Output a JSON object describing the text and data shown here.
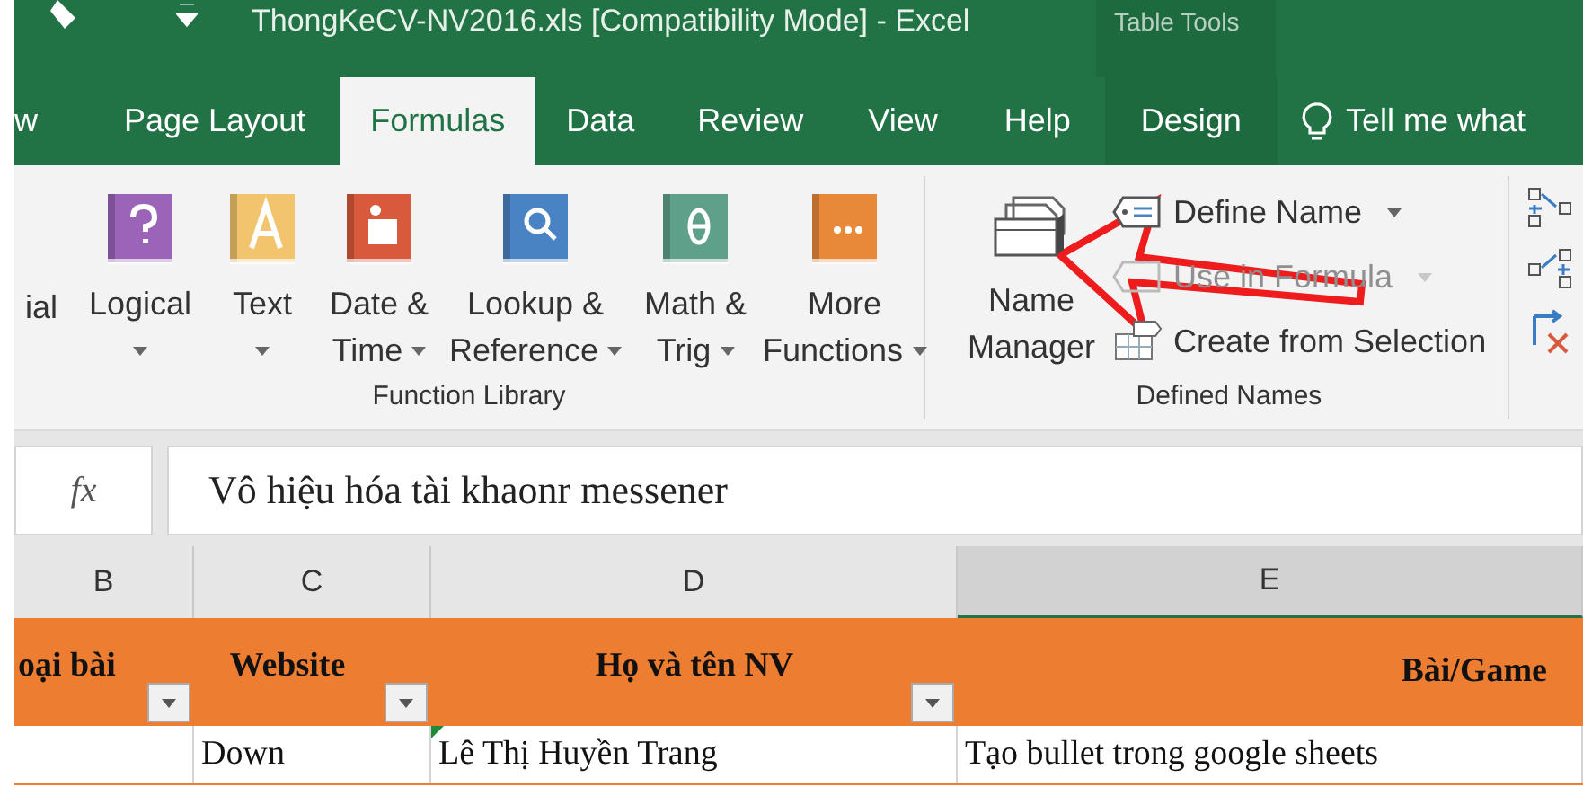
{
  "title_bar": {
    "title": "ThongKeCV-NV2016.xls  [Compatibility Mode]  -  Excel",
    "context_label": "Table Tools"
  },
  "tabs": [
    {
      "label": "w",
      "selected": false,
      "kind": "normal"
    },
    {
      "label": "Page Layout",
      "selected": false,
      "kind": "normal"
    },
    {
      "label": "Formulas",
      "selected": true,
      "kind": "normal"
    },
    {
      "label": "Data",
      "selected": false,
      "kind": "normal"
    },
    {
      "label": "Review",
      "selected": false,
      "kind": "normal"
    },
    {
      "label": "View",
      "selected": false,
      "kind": "normal"
    },
    {
      "label": "Help",
      "selected": false,
      "kind": "normal"
    },
    {
      "label": "Design",
      "selected": false,
      "kind": "contextual"
    },
    {
      "label": "Tell me what",
      "selected": false,
      "kind": "search"
    }
  ],
  "function_library": {
    "label": "Function Library",
    "buttons": [
      {
        "lines": [
          "ial"
        ],
        "dropdown": false
      },
      {
        "lines": [
          "Logical"
        ],
        "dropdown": true
      },
      {
        "lines": [
          "Text"
        ],
        "dropdown": true
      },
      {
        "lines": [
          "Date &",
          "Time"
        ],
        "dropdown": true
      },
      {
        "lines": [
          "Lookup &",
          "Reference"
        ],
        "dropdown": true
      },
      {
        "lines": [
          "Math &",
          "Trig"
        ],
        "dropdown": true
      },
      {
        "lines": [
          "More",
          "Functions"
        ],
        "dropdown": true
      }
    ]
  },
  "defined_names": {
    "label": "Defined Names",
    "manager": {
      "lines": [
        "Name",
        "Manager"
      ]
    },
    "commands": [
      {
        "label": "Define Name",
        "dropdown": true,
        "disabled": false
      },
      {
        "label": "Use in Formula",
        "dropdown": true,
        "disabled": true
      },
      {
        "label": "Create from Selection",
        "dropdown": false,
        "disabled": false
      }
    ]
  },
  "formula_bar": {
    "fx": "fx",
    "value": "Vô hiệu hóa tài khaonr messener"
  },
  "columns": [
    "B",
    "C",
    "D",
    "E"
  ],
  "table": {
    "headers": [
      {
        "text": "oại bài",
        "filter": true
      },
      {
        "text": "Website",
        "filter": true
      },
      {
        "text": "Họ và tên NV",
        "filter": true
      },
      {
        "text": "Bài/Game",
        "filter": false
      }
    ],
    "rows": [
      {
        "cells": [
          {},
          {
            "text": "Down"
          },
          {
            "text": "Lê Thị Huyền Trang",
            "flag": true
          },
          {
            "text": "Tạo bullet trong google sheets"
          }
        ]
      }
    ]
  }
}
